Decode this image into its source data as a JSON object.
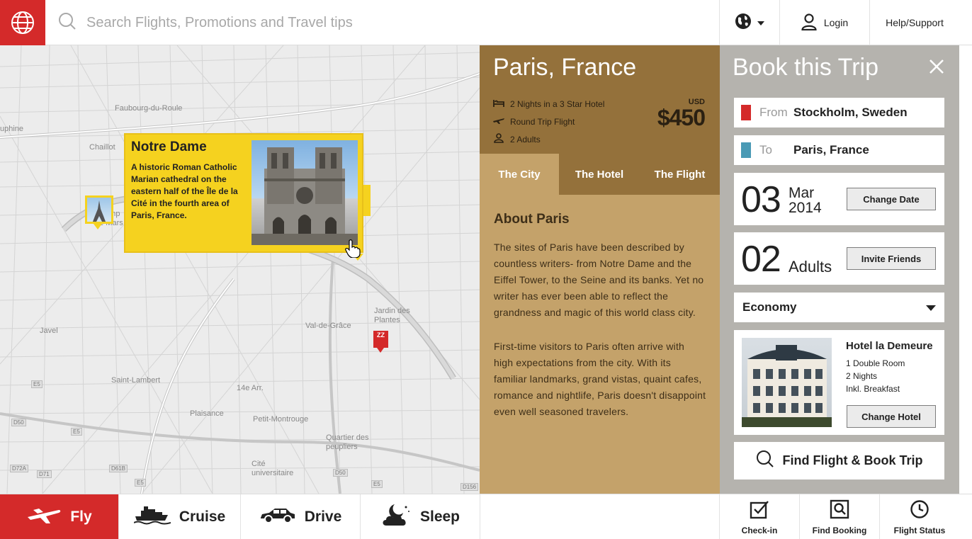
{
  "search": {
    "placeholder": "Search Flights, Promotions and Travel tips"
  },
  "header": {
    "login_label": "Login",
    "help_label": "Help/Support"
  },
  "map": {
    "labels": [
      "Faubourg-du-Roule",
      "Chaillot",
      "Champ de Mars",
      "Javel",
      "Saint-Lambert",
      "Plaisance",
      "Petit-Montrouge",
      "14e Arr.",
      "Val-de-Grâce",
      "Jardin des Plantes",
      "Quartier des peupliers",
      "Cité universitaire",
      "uphine"
    ],
    "shields": [
      "E5",
      "E5",
      "D50",
      "D72A",
      "D71",
      "D61B",
      "E5",
      "D50",
      "E5",
      "D156"
    ],
    "popup": {
      "title": "Notre Dame",
      "description": "A historic Roman Catholic Marian cathedral on the eastern half of the Île de la Cité in the fourth area of Paris, France."
    },
    "hotel_pin": "ZZ"
  },
  "destination": {
    "title": "Paris, France",
    "features": [
      "2 Nights in a 3 Star Hotel",
      "Round Trip Flight",
      "2 Adults"
    ],
    "currency": "USD",
    "price": "$450",
    "tabs": [
      "The City",
      "The Hotel",
      "The Flight"
    ],
    "active_tab": "The City",
    "about_title": "About Paris",
    "about_paragraphs": [
      "The sites of Paris have been described by countless writers- from Notre Dame and the Eiffel Tower, to the Seine and its banks. Yet no writer has ever been able to reflect the grandness and magic of this world class city.",
      "First-time visitors to Paris often arrive with high expectations from the city. With its familiar landmarks, grand vistas, quaint cafes, romance and nightlife, Paris doesn't disappoint even well seasoned travelers."
    ]
  },
  "booking": {
    "title": "Book this Trip",
    "from_label": "From",
    "from_value": "Stockholm, Sweden",
    "to_label": "To",
    "to_value": "Paris, France",
    "day": "03",
    "month": "Mar",
    "year": "2014",
    "change_date_label": "Change Date",
    "adults_count": "02",
    "adults_label": "Adults",
    "invite_label": "Invite Friends",
    "cabin_class": "Economy",
    "hotel": {
      "name": "Hotel la Demeure",
      "details": [
        "1 Double Room",
        "2 Nights",
        "Inkl. Breakfast"
      ],
      "change_label": "Change Hotel"
    },
    "find_label": "Find Flight & Book Trip"
  },
  "modes": [
    {
      "label": "Fly",
      "icon": "plane-icon",
      "active": true
    },
    {
      "label": "Cruise",
      "icon": "ship-icon",
      "active": false
    },
    {
      "label": "Drive",
      "icon": "car-icon",
      "active": false
    },
    {
      "label": "Sleep",
      "icon": "moon-cloud-icon",
      "active": false
    }
  ],
  "utilities": [
    {
      "label": "Check-in",
      "icon": "checkbox-icon"
    },
    {
      "label": "Find Booking",
      "icon": "magnifier-doc-icon"
    },
    {
      "label": "Flight Status",
      "icon": "clock-icon"
    }
  ],
  "colors": {
    "brand_red": "#d42a2a",
    "panel_brown_dark": "#94713b",
    "panel_brown_light": "#c4a26a",
    "booking_grey": "#b5b3ae",
    "highlight_yellow": "#f5d21f",
    "from_flag": "#d42a2a",
    "to_flag": "#4a9ab5"
  }
}
